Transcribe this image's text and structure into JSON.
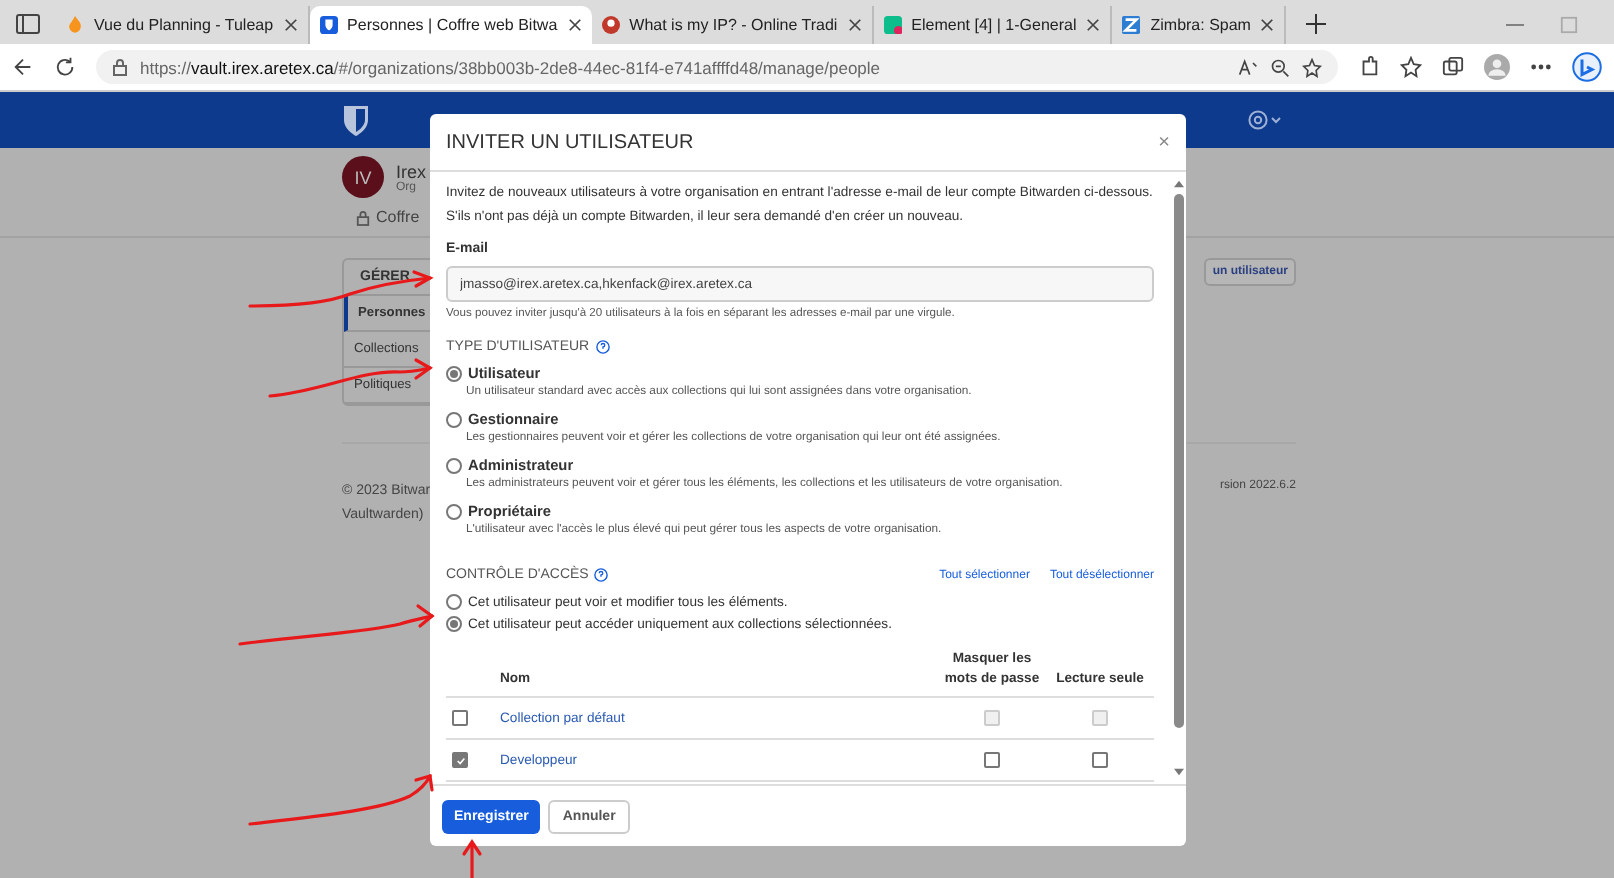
{
  "browser": {
    "tabs": [
      {
        "title": "Vue du Planning - Tuleap",
        "selected": false
      },
      {
        "title": "Personnes | Coffre web Bitwa",
        "selected": true
      },
      {
        "title": "What is my IP? - Online Tradi",
        "selected": false
      },
      {
        "title": "Element [4] | 1-General",
        "selected": false
      },
      {
        "title": "Zimbra: Spam",
        "selected": false
      }
    ],
    "address": "https://**vault.irex.aretex.ca**/#/organizations/38bb003b-2de8-44ec-81f4-e741affffd48/manage/people"
  },
  "page": {
    "org_avatar": "IV",
    "org_name": "Irex",
    "org_subtitle": "Org",
    "vault_tab": "Coffre",
    "sidebar": {
      "heading": "GÉRER",
      "items": [
        {
          "label": "Personnes",
          "selected": true
        },
        {
          "label": "Collections",
          "selected": false
        },
        {
          "label": "Politiques",
          "selected": false
        }
      ]
    },
    "invite_button": "un utilisateur",
    "footer_left": [
      "© 2023 Bitwar",
      "Vaultwarden)"
    ],
    "footer_right": "rsion 2022.6.2"
  },
  "dialog": {
    "title": "INVITER UN UTILISATEUR",
    "close": "×",
    "intro": "Invitez de nouveaux utilisateurs à votre organisation en entrant l'adresse e-mail de leur compte Bitwarden ci-dessous. S'ils n'ont pas déjà un compte Bitwarden, il leur sera demandé d'en créer un nouveau.",
    "email_label": "E-mail",
    "email_value": "jmasso@irex.aretex.ca,hkenfack@irex.aretex.ca",
    "email_hint": "Vous pouvez inviter jusqu'à 20 utilisateurs à la fois en séparant les adresses e-mail par une virgule.",
    "user_type": {
      "heading": "TYPE D'UTILISATEUR",
      "options": [
        {
          "label": "Utilisateur",
          "description": "Un utilisateur standard avec accès aux collections qui lui sont assignées dans votre organisation.",
          "selected": true
        },
        {
          "label": "Gestionnaire",
          "description": "Les gestionnaires peuvent voir et gérer les collections de votre organisation qui leur ont été assignées.",
          "selected": false
        },
        {
          "label": "Administrateur",
          "description": "Les administrateurs peuvent voir et gérer tous les éléments, les collections et les utilisateurs de votre organisation.",
          "selected": false
        },
        {
          "label": "Propriétaire",
          "description": "L'utilisateur avec l'accès le plus élevé qui peut gérer tous les aspects de votre organisation.",
          "selected": false
        }
      ]
    },
    "access": {
      "heading": "CONTRÔLE D'ACCÈS",
      "select_all": "Tout sélectionner",
      "deselect_all": "Tout désélectionner",
      "options": [
        {
          "label": "Cet utilisateur peut voir et modifier tous les éléments.",
          "selected": false
        },
        {
          "label": "Cet utilisateur peut accéder uniquement aux collections sélectionnées.",
          "selected": true
        }
      ],
      "columns": [
        "Nom",
        "Masquer les mots de passe",
        "Lecture seule"
      ],
      "rows": [
        {
          "name": "Collection par défaut",
          "checked": false,
          "hide_passwords": false,
          "read_only": false
        },
        {
          "name": "Developpeur",
          "checked": true,
          "hide_passwords": false,
          "read_only": false
        }
      ]
    },
    "save": "Enregistrer",
    "cancel": "Annuler"
  }
}
